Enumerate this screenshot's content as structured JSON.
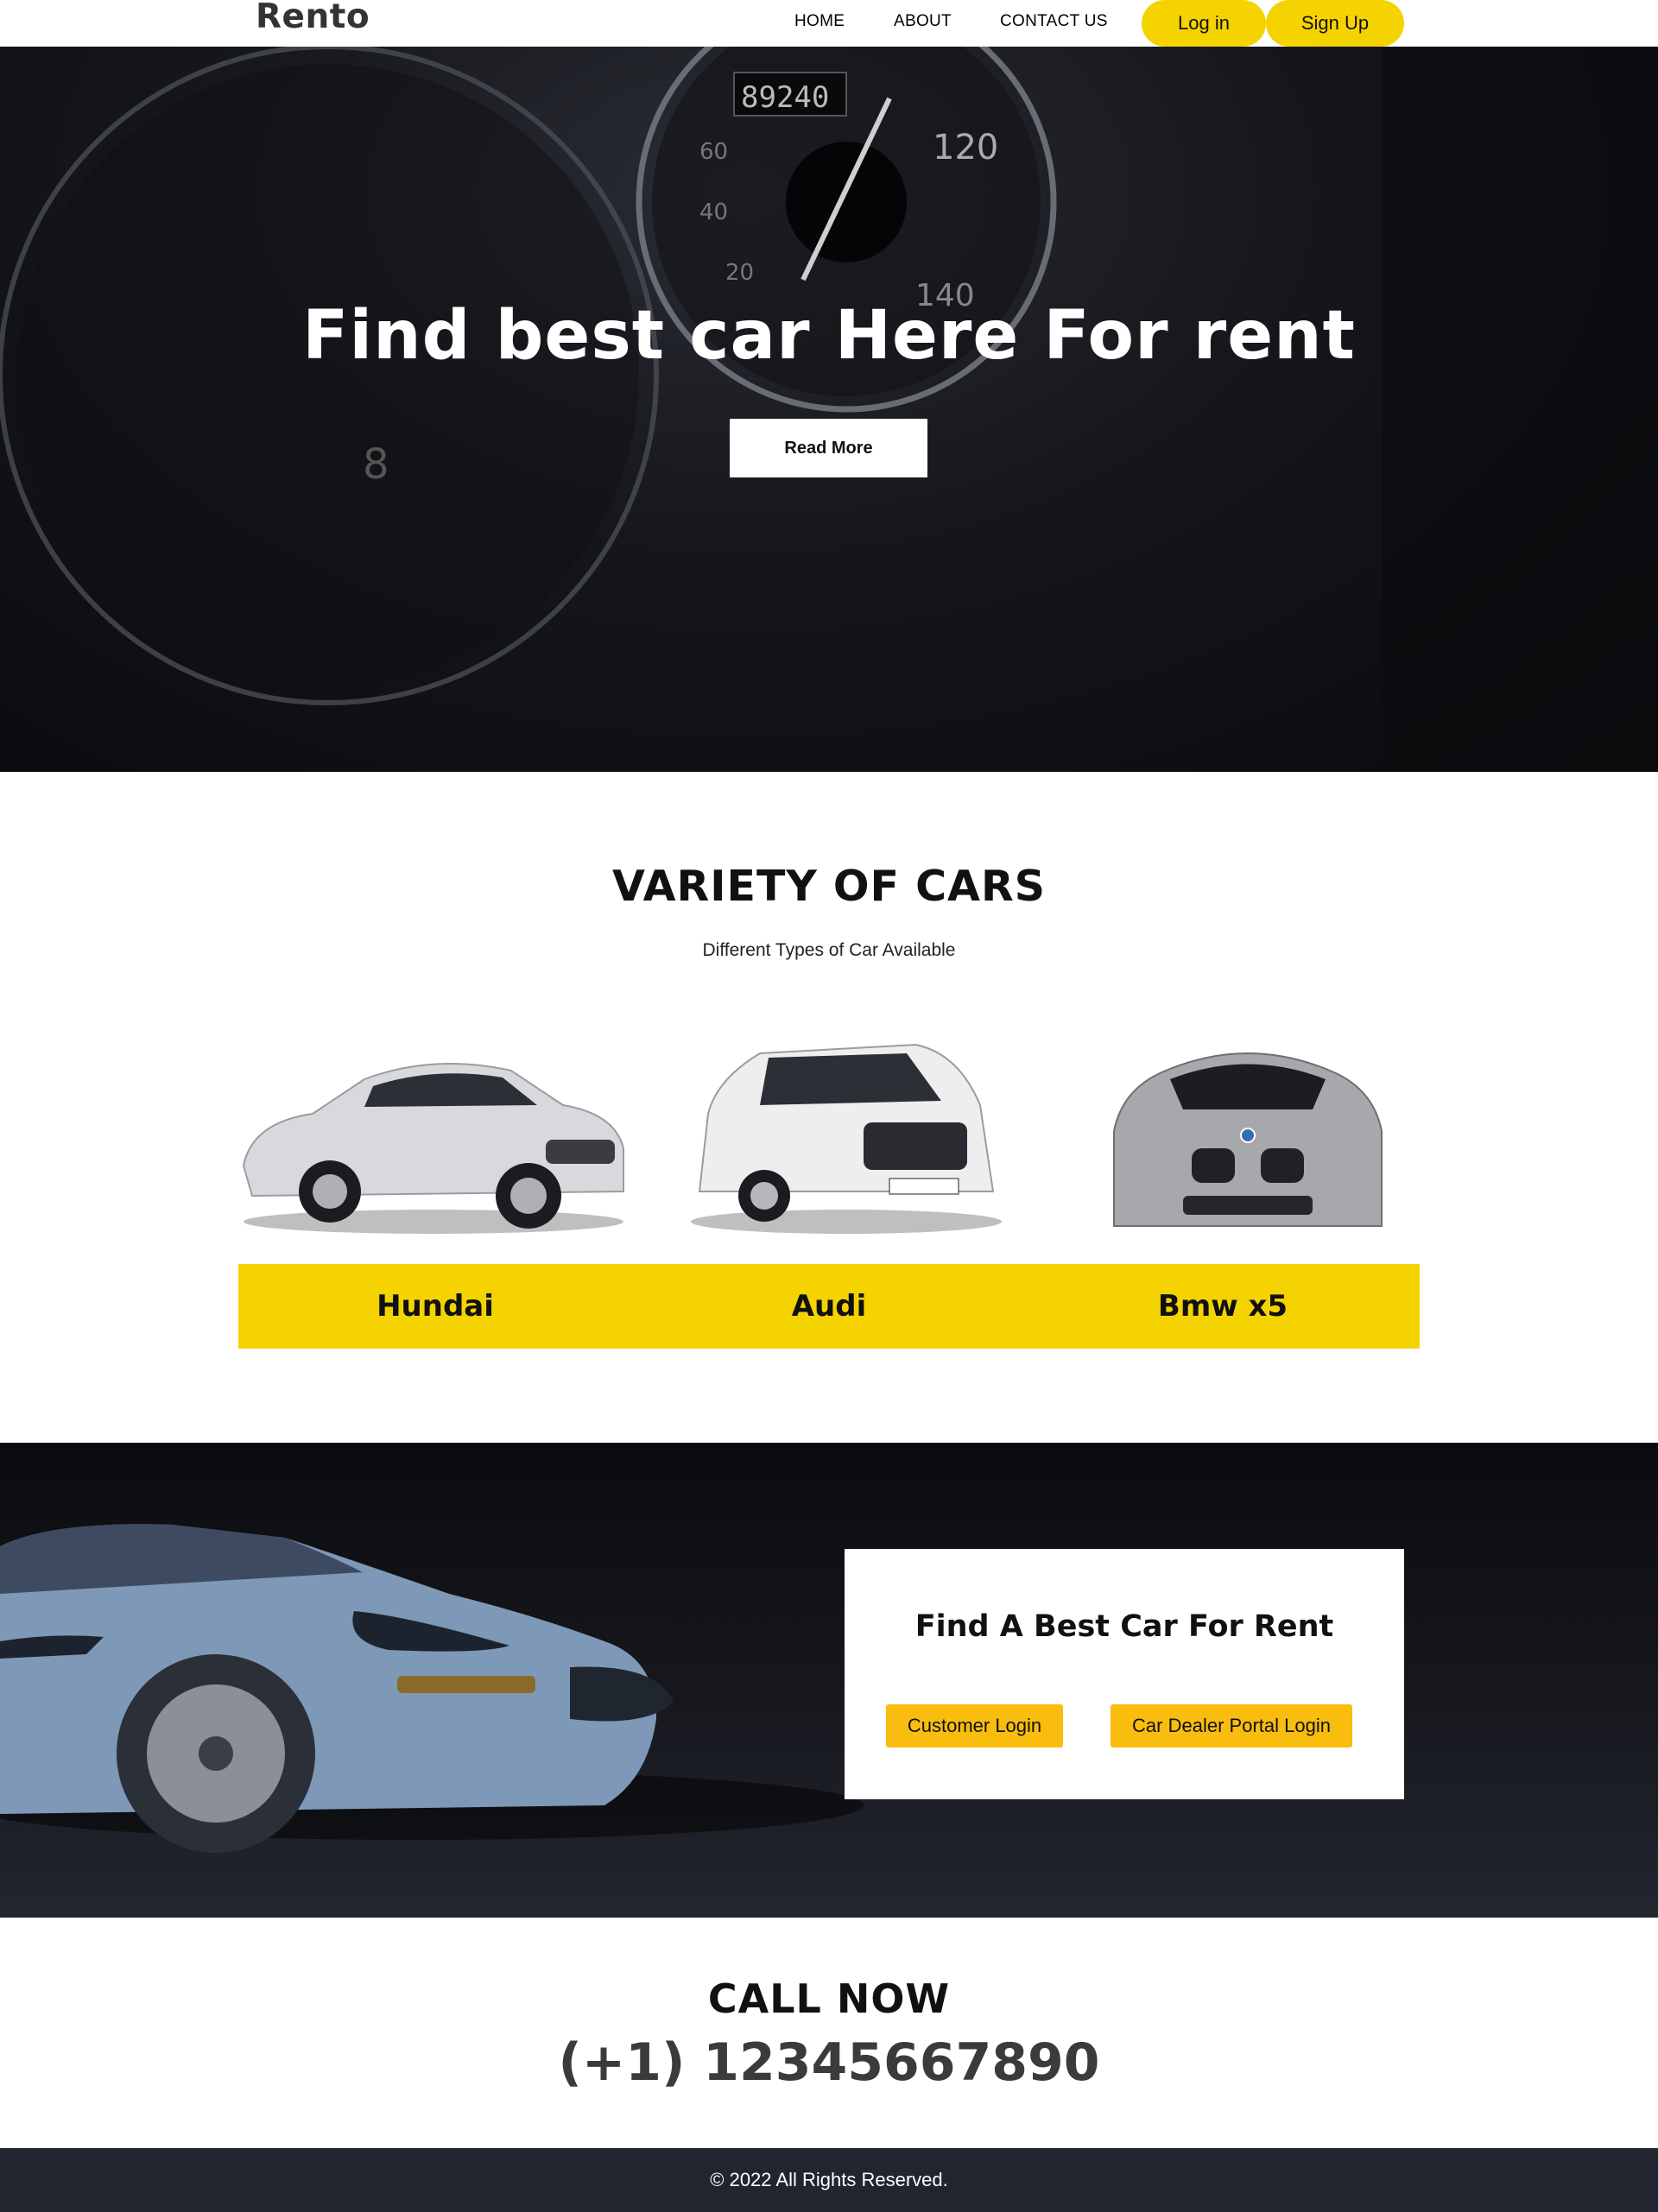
{
  "navbar": {
    "logo": "Rento",
    "links": [
      "HOME",
      "ABOUT",
      "CONTACT US"
    ],
    "login_label": "Log in",
    "signup_label": "Sign Up"
  },
  "hero": {
    "title": "Find best car Here For rent",
    "button_label": "Read More"
  },
  "variety": {
    "title": "VARIETY OF CARS",
    "subtitle": "Different Types of Car Available",
    "cars": [
      {
        "name": "Hundai",
        "image_icon": "silver-sedan-image"
      },
      {
        "name": "Audi",
        "image_icon": "white-suv-image"
      },
      {
        "name": "Bmw x5",
        "image_icon": "silver-coupe-front-image"
      }
    ]
  },
  "promo": {
    "title": "Find A Best Car For Rent",
    "customer_login_label": "Customer Login",
    "dealer_login_label": "Car Dealer Portal Login",
    "image_icon": "blue-convertible-image"
  },
  "call": {
    "title": "CALL NOW",
    "phone": "(+1) 12345667890"
  },
  "footer": {
    "text": "© 2022 All Rights Reserved."
  },
  "colors": {
    "accent_yellow": "#f5d300",
    "button_yellow": "#f8bd0e",
    "footer_bg": "#22252f",
    "dark_text": "#111111"
  }
}
